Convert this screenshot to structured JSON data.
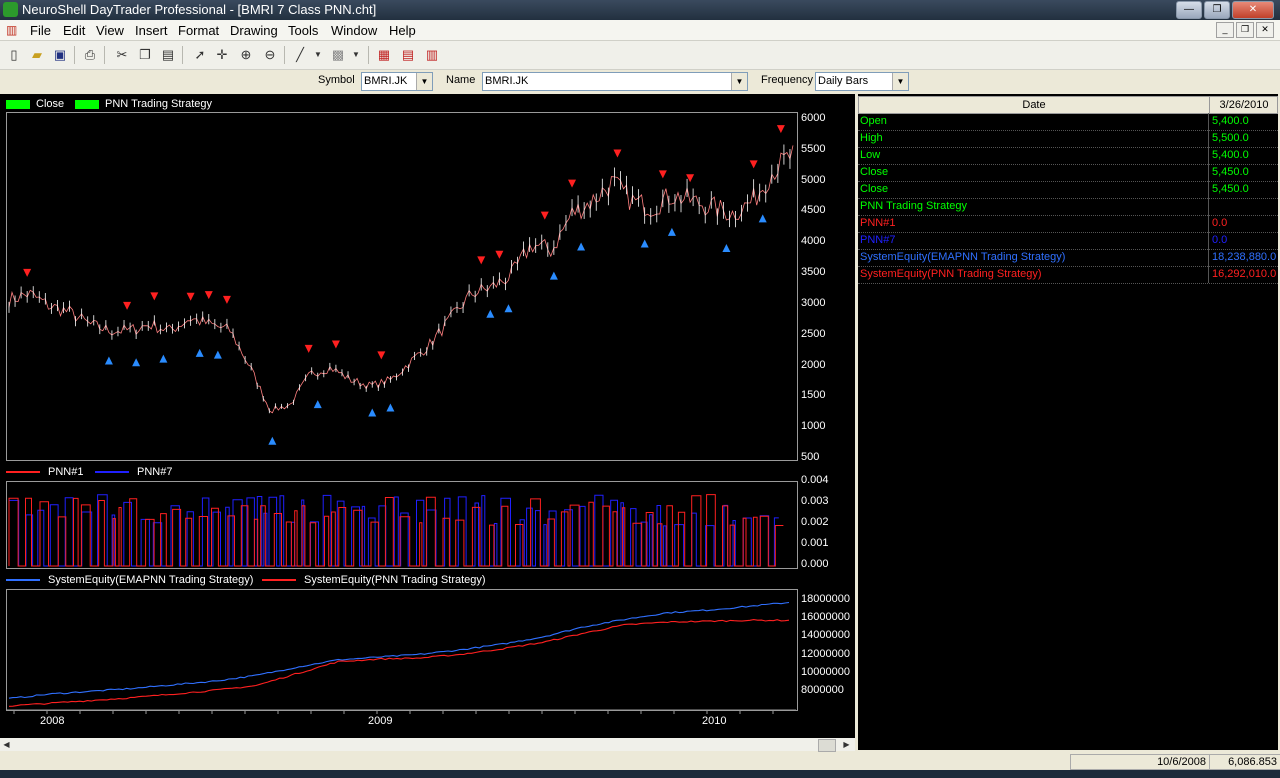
{
  "window": {
    "title": "NeuroShell DayTrader Professional - [BMRI 7 Class PNN.cht]",
    "minimize": "—",
    "restore": "❐",
    "close": "✕"
  },
  "menu": [
    {
      "label": "File"
    },
    {
      "label": "Edit"
    },
    {
      "label": "View"
    },
    {
      "label": "Insert"
    },
    {
      "label": "Format"
    },
    {
      "label": "Drawing"
    },
    {
      "label": "Tools"
    },
    {
      "label": "Window"
    },
    {
      "label": "Help"
    }
  ],
  "symbolbar": {
    "symbol_label": "Symbol",
    "symbol_value": "BMRI.JK",
    "name_label": "Name",
    "name_value": "BMRI.JK",
    "frequency_label": "Frequency",
    "frequency_value": "Daily Bars"
  },
  "price_chart": {
    "legend": [
      {
        "label": "Close",
        "color": "#00ff00"
      },
      {
        "label": "PNN Trading Strategy",
        "color": "#00ff00"
      }
    ],
    "yticks": [
      "6000",
      "5500",
      "5000",
      "4500",
      "4000",
      "3500",
      "3000",
      "2500",
      "2000",
      "1500",
      "1000",
      "500"
    ]
  },
  "pnn_chart": {
    "legend": [
      {
        "label": "PNN#1",
        "color": "#ff2020"
      },
      {
        "label": "PNN#7",
        "color": "#2020ff"
      }
    ],
    "yticks": [
      "0.004",
      "0.003",
      "0.002",
      "0.001",
      "0.000"
    ]
  },
  "equity_chart": {
    "legend": [
      {
        "label": "SystemEquity(EMAPNN Trading Strategy)",
        "color": "#3070ff"
      },
      {
        "label": "SystemEquity(PNN Trading Strategy)",
        "color": "#ff2020"
      }
    ],
    "yticks": [
      "18000000",
      "16000000",
      "14000000",
      "12000000",
      "10000000",
      "8000000"
    ]
  },
  "xaxis": {
    "labels": [
      "2008",
      "2009",
      "2010"
    ]
  },
  "chart_data": [
    {
      "type": "line",
      "name": "price",
      "x_labels": [
        "2008",
        "2009",
        "2010"
      ],
      "series": [
        {
          "name": "Close",
          "values": [
            3100,
            3200,
            3000,
            2900,
            2700,
            2600,
            2600,
            2700,
            2600,
            2800,
            2700,
            2600,
            2000,
            1300,
            1400,
            1900,
            2000,
            1800,
            1700,
            1800,
            2100,
            2400,
            2800,
            3200,
            3300,
            3500,
            4000,
            3900,
            4500,
            4700,
            5000,
            4700,
            4600,
            4800,
            4700,
            4600,
            4500,
            4700,
            5200,
            5450
          ]
        }
      ],
      "ylim": [
        500,
        6000
      ]
    },
    {
      "type": "line",
      "name": "pnn",
      "series": [
        {
          "name": "PNN#1"
        },
        {
          "name": "PNN#7"
        }
      ],
      "ylim": [
        0,
        0.004
      ]
    },
    {
      "type": "line",
      "name": "equity",
      "series": [
        {
          "name": "SystemEquity(EMAPNN Trading Strategy)",
          "values": [
            7800000,
            8300000,
            8600000,
            8900000,
            9300000,
            9700000,
            10300000,
            11200000,
            12000000,
            12300000,
            12600000,
            13100000,
            13700000,
            14500000,
            15600000,
            16400000,
            17100000,
            17400000,
            17800000,
            18238880
          ]
        },
        {
          "name": "SystemEquity(PNN Trading Strategy)",
          "values": [
            7000000,
            7300000,
            7600000,
            7900000,
            8300000,
            8700000,
            9200000,
            10500000,
            11800000,
            12100000,
            12200000,
            12600000,
            13200000,
            13900000,
            14900000,
            15800000,
            16100000,
            16200000,
            16300000,
            16292010
          ]
        }
      ],
      "ylim": [
        7000000,
        18500000
      ]
    }
  ],
  "datapanel": {
    "header_date": "Date",
    "header_value": "3/26/2010",
    "rows": [
      {
        "label": "Open",
        "value": "5,400.0",
        "color": "#00ff00"
      },
      {
        "label": "High",
        "value": "5,500.0",
        "color": "#00ff00"
      },
      {
        "label": "Low",
        "value": "5,400.0",
        "color": "#00ff00"
      },
      {
        "label": "Close",
        "value": "5,450.0",
        "color": "#00ff00"
      },
      {
        "label": "Close",
        "value": "5,450.0",
        "color": "#00ff00"
      },
      {
        "label": "PNN Trading Strategy",
        "value": "",
        "color": "#00ff00"
      },
      {
        "label": "PNN#1",
        "value": "0.0",
        "color": "#ff2020"
      },
      {
        "label": "PNN#7",
        "value": "0.0",
        "color": "#2020ff"
      },
      {
        "label": "SystemEquity(EMAPNN Trading Strategy)",
        "value": "18,238,880.0",
        "color": "#3070ff"
      },
      {
        "label": "SystemEquity(PNN Trading Strategy)",
        "value": "16,292,010.0",
        "color": "#ff2020"
      }
    ]
  },
  "status": {
    "date": "10/6/2008",
    "value": "6,086.853"
  }
}
